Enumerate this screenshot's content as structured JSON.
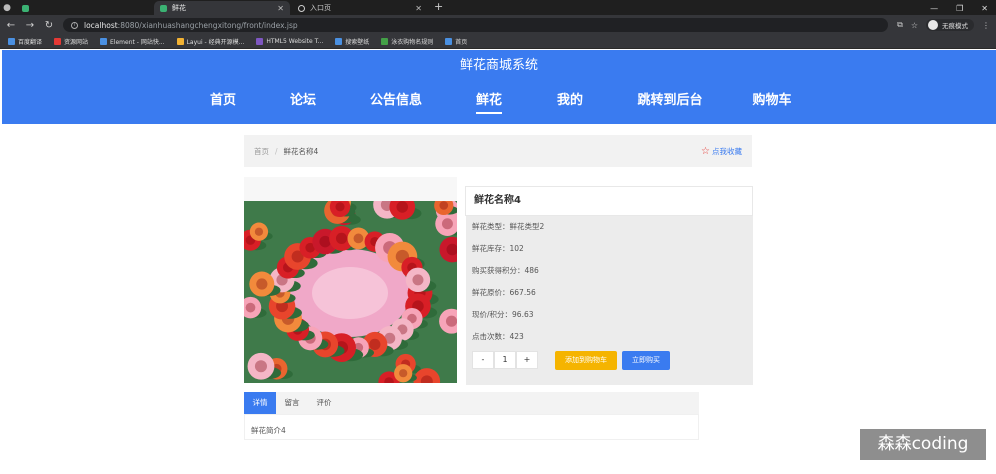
{
  "browser": {
    "tabs": [
      {
        "title": "",
        "active": false
      },
      {
        "title": "鲜花",
        "active": true
      },
      {
        "title": "入口页",
        "active": false
      }
    ],
    "url_host": "localhost",
    "url_rest": ":8080/xianhuashangchengxitong/front/index.jsp",
    "profile_label": "无痕模式",
    "bookmarks": [
      "百度翻译",
      "资源网站",
      "Element - 网站快...",
      "Layui - 经典开源模...",
      "HTML5 Website T...",
      "搜索壁纸",
      "泳衣购物名规则",
      "首页"
    ]
  },
  "site": {
    "title": "鲜花商城系统",
    "nav": [
      "首页",
      "论坛",
      "公告信息",
      "鲜花",
      "我的",
      "跳转到后台",
      "购物车"
    ],
    "active_nav": "鲜花"
  },
  "breadcrumb": {
    "home": "首页",
    "separator": "/",
    "current": "鲜花名称4"
  },
  "favorite_label": "点我收藏",
  "product": {
    "name": "鲜花名称4",
    "attrs": [
      "鲜花类型：鲜花类型2",
      "鲜花库存：102",
      "购买获得积分：486",
      "鲜花原价：667.56",
      "现价/积分：96.63",
      "点击次数：423"
    ],
    "quantity": "1",
    "minus": "-",
    "plus": "+",
    "add_to_cart": "添加到购物车",
    "buy_now": "立即购买"
  },
  "detail_tabs": [
    "详情",
    "留言",
    "评价"
  ],
  "active_detail_tab": "详情",
  "detail_text": "鲜花简介4",
  "watermark": "森森coding",
  "colors": {
    "brand": "#3a7bf0",
    "cart": "#f5b400",
    "star": "#e53935"
  }
}
